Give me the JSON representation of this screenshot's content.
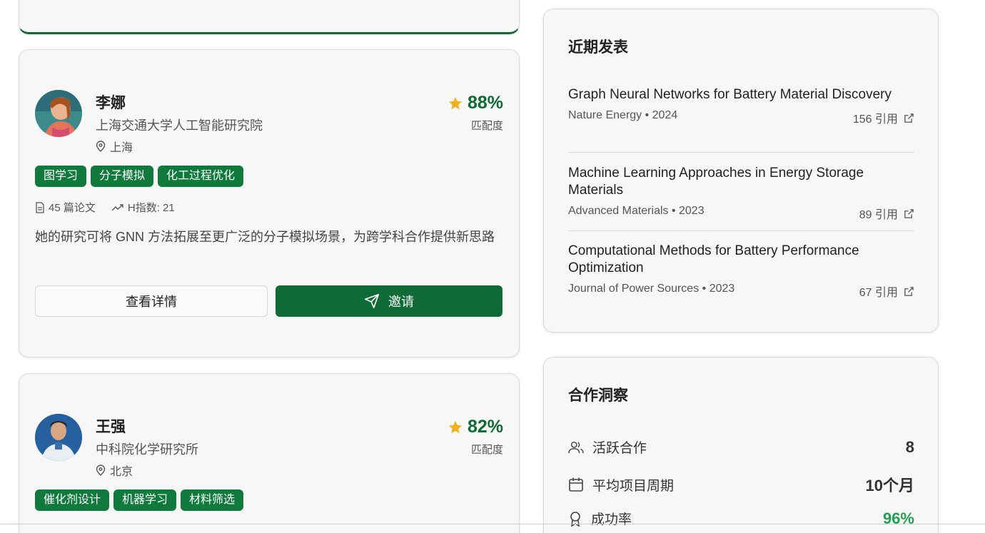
{
  "researchers": [
    {
      "name": "李娜",
      "institution": "上海交通大学人工智能研究院",
      "location": "上海",
      "match_pct": "88%",
      "match_label": "匹配度",
      "match_value": 88,
      "tags": [
        "图学习",
        "分子模拟",
        "化工过程优化"
      ],
      "papers": "45 篇论文",
      "hindex": "H指数: 21",
      "description": "她的研究可将 GNN 方法拓展至更广泛的分子模拟场景，为跨学科合作提供新思路",
      "detail_button": "查看详情",
      "invite_button": "邀请"
    },
    {
      "name": "王强",
      "institution": "中科院化学研究所",
      "location": "北京",
      "match_pct": "82%",
      "match_label": "匹配度",
      "match_value": 82,
      "tags": [
        "催化剂设计",
        "机器学习",
        "材料筛选"
      ]
    }
  ],
  "publications": {
    "title": "近期发表",
    "items": [
      {
        "title": "Graph Neural Networks for Battery Material Discovery",
        "venue": "Nature Energy • 2024",
        "citations": "156 引用"
      },
      {
        "title": "Machine Learning Approaches in Energy Storage Materials",
        "venue": "Advanced Materials • 2023",
        "citations": "89 引用"
      },
      {
        "title": "Computational Methods for Battery Performance Optimization",
        "venue": "Journal of Power Sources • 2023",
        "citations": "67 引用"
      }
    ]
  },
  "insights": {
    "title": "合作洞察",
    "items": [
      {
        "icon": "users-icon",
        "label": "活跃合作",
        "value": "8"
      },
      {
        "icon": "calendar-icon",
        "label": "平均项目周期",
        "value": "10个月"
      },
      {
        "icon": "award-icon",
        "label": "成功率",
        "value": "96%",
        "color": "#22a050"
      }
    ]
  },
  "colors": {
    "brand_green": "#0f6b35",
    "tag_green": "#0f7a3c",
    "star": "#f2b01e",
    "success": "#22a050"
  }
}
